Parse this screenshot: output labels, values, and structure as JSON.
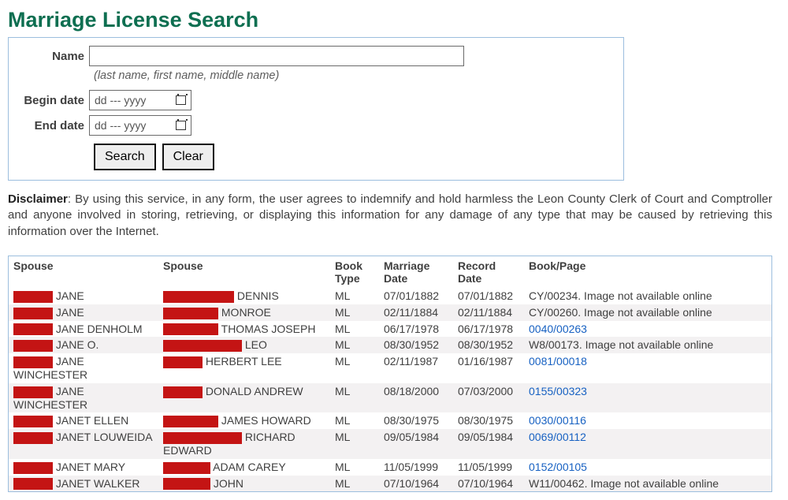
{
  "title": "Marriage License Search",
  "form": {
    "name_label": "Name",
    "name_value": "",
    "name_hint": "(last name, first name, middle name)",
    "begin_label": "Begin date",
    "begin_placeholder": "dd --- yyyy",
    "end_label": "End date",
    "end_placeholder": "dd --- yyyy",
    "search_btn": "Search",
    "clear_btn": "Clear"
  },
  "disclaimer_label": "Disclaimer",
  "disclaimer_text": ": By using this service, in any form, the user agrees to indemnify and hold harmless the Leon County Clerk of Court and Comptroller and anyone involved in storing, retrieving, or displaying this information for any damage of any type that may be caused by retrieving this information over the Internet.",
  "columns": {
    "spouse1": "Spouse",
    "spouse2": "Spouse",
    "book_type": "Book Type",
    "marriage_date": "Marriage Date",
    "record_date": "Record Date",
    "book_page": "Book/Page"
  },
  "rows": [
    {
      "s1w": "r1",
      "s1": "JANE",
      "s2w": "r4",
      "s2": "DENNIS",
      "bt": "ML",
      "md": "07/01/1882",
      "rd": "07/01/1882",
      "bp": "CY/00234. Image not available online",
      "link": false
    },
    {
      "s1w": "r1",
      "s1": "JANE",
      "s2w": "r3",
      "s2": "MONROE",
      "bt": "ML",
      "md": "02/11/1884",
      "rd": "02/11/1884",
      "bp": "CY/00260. Image not available online",
      "link": false
    },
    {
      "s1w": "r1",
      "s1": "JANE DENHOLM",
      "s2w": "r3",
      "s2": "THOMAS JOSEPH",
      "bt": "ML",
      "md": "06/17/1978",
      "rd": "06/17/1978",
      "bp": "0040/00263",
      "link": true
    },
    {
      "s1w": "r1",
      "s1": "JANE O.",
      "s2w": "r5",
      "s2": "LEO",
      "bt": "ML",
      "md": "08/30/1952",
      "rd": "08/30/1952",
      "bp": "W8/00173. Image not available online",
      "link": false
    },
    {
      "s1w": "r1",
      "s1": "JANE WINCHESTER",
      "s2w": "r1",
      "s2": "HERBERT LEE",
      "bt": "ML",
      "md": "02/11/1987",
      "rd": "01/16/1987",
      "bp": "0081/00018",
      "link": true
    },
    {
      "s1w": "r1",
      "s1": "JANE WINCHESTER",
      "s2w": "r1",
      "s2": "DONALD ANDREW",
      "bt": "ML",
      "md": "08/18/2000",
      "rd": "07/03/2000",
      "bp": "0155/00323",
      "link": true
    },
    {
      "s1w": "r1",
      "s1": "JANET ELLEN",
      "s2w": "r3",
      "s2": "JAMES HOWARD",
      "bt": "ML",
      "md": "08/30/1975",
      "rd": "08/30/1975",
      "bp": "0030/00116",
      "link": true
    },
    {
      "s1w": "r1",
      "s1": "JANET LOUWEIDA",
      "s2w": "r5",
      "s2": "RICHARD EDWARD",
      "bt": "ML",
      "md": "09/05/1984",
      "rd": "09/05/1984",
      "bp": "0069/00112",
      "link": true
    },
    {
      "s1w": "r1",
      "s1": "JANET MARY",
      "s2w": "r2",
      "s2": "ADAM CAREY",
      "bt": "ML",
      "md": "11/05/1999",
      "rd": "11/05/1999",
      "bp": "0152/00105",
      "link": true
    },
    {
      "s1w": "r1",
      "s1": "JANET WALKER",
      "s2w": "r2",
      "s2": "JOHN",
      "bt": "ML",
      "md": "07/10/1964",
      "rd": "07/10/1964",
      "bp": "W11/00462. Image not available online",
      "link": false
    }
  ]
}
